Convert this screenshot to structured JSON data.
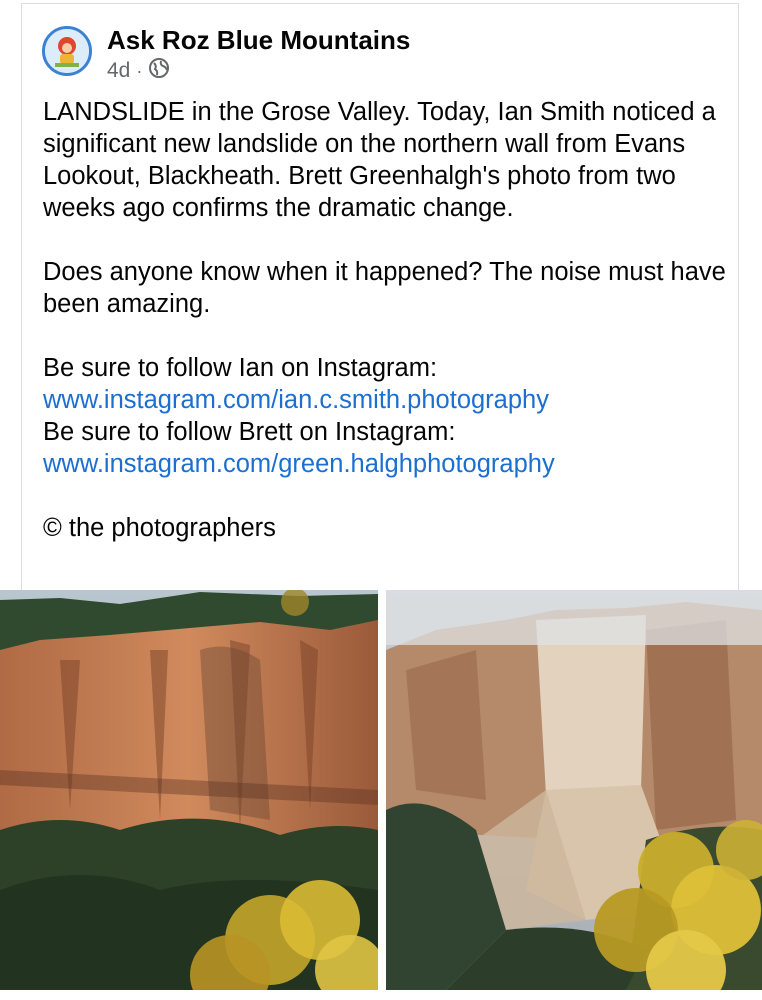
{
  "post": {
    "page_name": "Ask Roz Blue Mountains",
    "time_ago": "4d",
    "separator": "·",
    "audience_icon": "globe-icon",
    "paragraphs": {
      "p1": "LANDSLIDE in the Grose Valley.  Today, Ian Smith noticed a significant new landslide on the northern wall from Evans Lookout, Blackheath. Brett Greenhalgh's photo from two weeks ago confirms the dramatic change.",
      "p2": "Does anyone know when it happened? The noise must have been amazing.",
      "follow_ian": "Be sure to follow Ian on Instagram:",
      "link_ian": "www.instagram.com/ian.c.smith.photography",
      "follow_brett": "Be sure to follow Brett on Instagram:",
      "link_brett": "www.instagram.com/green.halghphotography",
      "copyright": "© the photographers"
    }
  },
  "photos": {
    "left": "cliff-before-photo",
    "right": "landslide-after-photo"
  },
  "colors": {
    "link": "#1b6fd1",
    "meta_text": "#65676b",
    "avatar_ring": "#3b82d6"
  }
}
